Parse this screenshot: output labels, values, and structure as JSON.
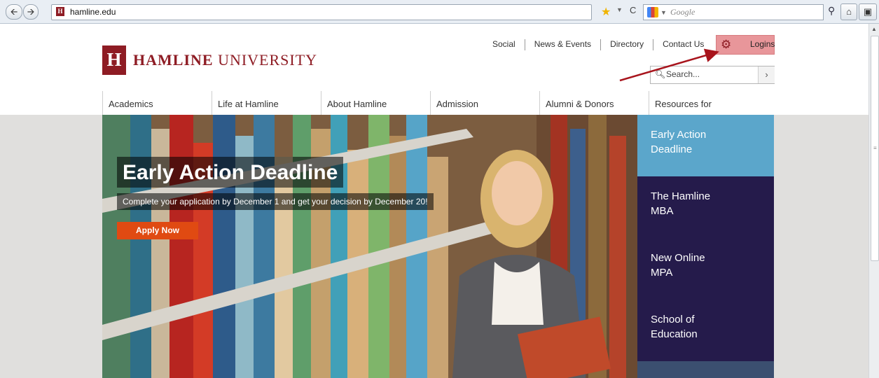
{
  "browser": {
    "url": "hamline.edu",
    "search_placeholder": "Google",
    "back_glyph": "🡨",
    "fwd_glyph": "🡪"
  },
  "header": {
    "logo_letter": "H",
    "logo_bold": "HAMLINE",
    "logo_light": "UNIVERSITY",
    "utility_links": [
      "Social",
      "News & Events",
      "Directory",
      "Contact Us"
    ],
    "logins_label": "Logins",
    "search_placeholder": "Search...",
    "nav": [
      "Academics",
      "Life at Hamline",
      "About Hamline",
      "Admission",
      "Alumni & Donors",
      "Resources for"
    ]
  },
  "hero": {
    "title": "Early Action Deadline",
    "subtitle": "Complete your application by December 1 and get your decision by December 20!",
    "cta": "Apply Now"
  },
  "promos": [
    {
      "label": "Early Action\nDeadline",
      "color": "#5ba6cb"
    },
    {
      "label": "The Hamline\nMBA",
      "color": "#251b4b"
    },
    {
      "label": "New Online\nMPA",
      "color": "#251b4b"
    },
    {
      "label": "School of\nEducation",
      "color": "#251b4b"
    },
    {
      "label": "",
      "color": "#3b4f70"
    }
  ],
  "colors": {
    "brand": "#8e1c24",
    "cta": "#e04a12",
    "logins_bg": "#e8969a",
    "annotation_arrow": "#a8141c"
  }
}
